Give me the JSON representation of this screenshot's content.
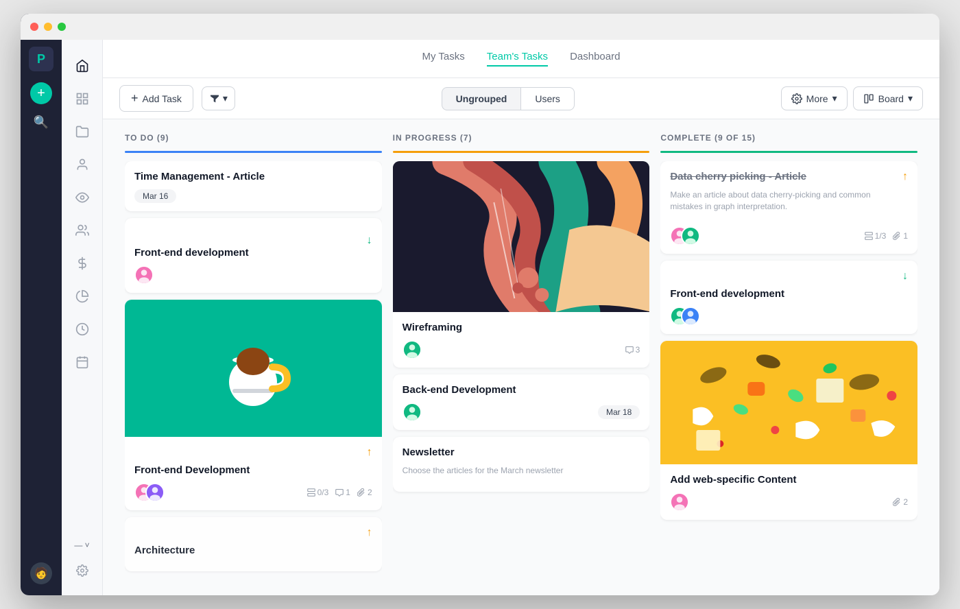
{
  "window": {
    "titlebar": {
      "dots": [
        "red",
        "yellow",
        "green"
      ]
    }
  },
  "tabs": [
    {
      "label": "My Tasks",
      "active": false
    },
    {
      "label": "Team's Tasks",
      "active": true
    },
    {
      "label": "Dashboard",
      "active": false
    }
  ],
  "toolbar": {
    "add_task_label": "Add Task",
    "filter_label": "",
    "group_options": [
      "Ungrouped",
      "Users"
    ],
    "more_label": "More",
    "board_label": "Board"
  },
  "columns": [
    {
      "id": "todo",
      "header": "TO DO",
      "count": 9,
      "color": "blue",
      "cards": [
        {
          "id": "todo-1",
          "title": "Time Management - Article",
          "tag": "Mar 16",
          "priority": null,
          "avatars": [],
          "meta": [],
          "image": null,
          "desc": null
        },
        {
          "id": "todo-2",
          "title": "Front-end development",
          "tag": null,
          "priority": "down",
          "avatars": [
            "pink"
          ],
          "meta": [],
          "image": null,
          "desc": null
        },
        {
          "id": "todo-3",
          "title": "Front-end Development",
          "tag": null,
          "priority": "up",
          "avatars": [
            "pink",
            "purple"
          ],
          "meta": [
            {
              "icon": "subtask",
              "value": "0/3"
            },
            {
              "icon": "comment",
              "value": "1"
            },
            {
              "icon": "attachment",
              "value": "2"
            }
          ],
          "image": "coffee",
          "desc": null
        },
        {
          "id": "todo-4",
          "title": "Architecture",
          "tag": null,
          "priority": "up",
          "avatars": [],
          "meta": [],
          "image": null,
          "desc": null
        }
      ]
    },
    {
      "id": "inprogress",
      "header": "IN PROGRESS",
      "count": 7,
      "color": "orange",
      "cards": [
        {
          "id": "ip-1",
          "title": "Wireframing",
          "tag": null,
          "priority": null,
          "avatars": [
            "green"
          ],
          "meta": [
            {
              "icon": "comment",
              "value": "3"
            }
          ],
          "image": "art",
          "desc": null
        },
        {
          "id": "ip-2",
          "title": "Back-end Development",
          "tag": "Mar 18",
          "priority": null,
          "avatars": [
            "green"
          ],
          "meta": [],
          "image": null,
          "desc": null
        },
        {
          "id": "ip-3",
          "title": "Newsletter",
          "tag": null,
          "priority": null,
          "avatars": [],
          "meta": [],
          "image": null,
          "desc": "Choose the articles for the March newsletter"
        }
      ]
    },
    {
      "id": "complete",
      "header": "COMPLETE",
      "count": "9 of 15",
      "color": "green",
      "cards": [
        {
          "id": "comp-1",
          "title": "Data cherry picking - Article",
          "tag": null,
          "priority": "up",
          "avatars": [
            "pink",
            "green"
          ],
          "meta": [
            {
              "icon": "subtask",
              "value": "1/3"
            },
            {
              "icon": "attachment",
              "value": "1"
            }
          ],
          "image": null,
          "desc": "Make an article about data cherry-picking and common mistakes in graph interpretation.",
          "strikethrough": true
        },
        {
          "id": "comp-2",
          "title": "Front-end development",
          "tag": null,
          "priority": "down",
          "avatars": [
            "green",
            "blue"
          ],
          "meta": [],
          "image": null,
          "desc": null
        },
        {
          "id": "comp-3",
          "title": "Add web-specific Content",
          "tag": null,
          "priority": null,
          "avatars": [
            "pink"
          ],
          "meta": [
            {
              "icon": "attachment",
              "value": "2"
            }
          ],
          "image": "food",
          "desc": null
        }
      ]
    }
  ],
  "icons": {
    "home": "⌂",
    "grid": "⊞",
    "folder": "📁",
    "user": "👤",
    "eye": "👁",
    "users": "👥",
    "dollar": "$",
    "pie": "◔",
    "clock": "⏱",
    "calendar": "📅",
    "search": "⌕",
    "plus": "+",
    "filter": "⬦",
    "chevron": "▾",
    "gear": "⚙",
    "board": "▦",
    "subtask": "⊏",
    "comment": "💬",
    "attachment": "📎",
    "expand": "— ˅"
  }
}
